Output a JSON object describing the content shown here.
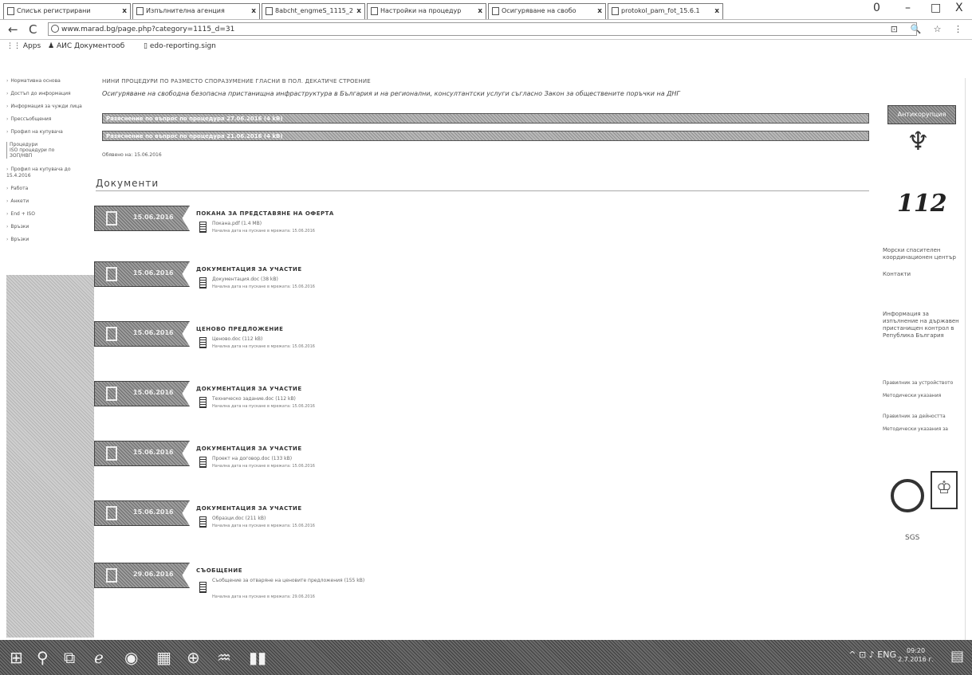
{
  "tabs": [
    {
      "label": "Списък регистрирани",
      "icon": "user-icon"
    },
    {
      "label": "Изпълнителна агенция",
      "icon": "agency-icon"
    },
    {
      "label": "8abcht_engmeS_1115_2",
      "icon": "page-icon"
    },
    {
      "label": "Настройки на процедур",
      "icon": "page-icon"
    },
    {
      "label": "Осигуряване на свобо",
      "icon": "page-icon"
    },
    {
      "label": "protokol_pam_fot_15.6.1",
      "icon": "page-icon"
    }
  ],
  "window_controls": {
    "profile": "0",
    "minimize": "–",
    "maximize": "□",
    "close": "X"
  },
  "address": {
    "url": "www.marad.bg/page.php?category=1115_d=31",
    "back": "←",
    "reload": "C",
    "icons": "⊡ 🔍 ☆ ⋮"
  },
  "bookmarks": [
    {
      "label": "Apps",
      "icon": "apps-icon"
    },
    {
      "label": "AИС Документооб",
      "icon": "user-icon"
    },
    {
      "label": "edo-reporting.sign",
      "icon": "page-icon"
    }
  ],
  "sidebar": {
    "items": [
      "Нормативна основа",
      "Достъп до информация",
      "Информация за чужди лица",
      "Прессъобщения",
      "Профил на купувача",
      "Профил на купувача до 15.4.2016",
      "Работа",
      "Анкети",
      "Еnd + ISO",
      "Връзки",
      "Връзки"
    ],
    "sub": [
      "Процедури",
      "ISO процедури по",
      "ЗОП/НВП"
    ]
  },
  "main": {
    "crumb": "НИНИ ПРОЦЕДУРИ ПО РАЗМЕСТО СПОРАЗУМЕНИЕ ГЛАСНИ В ПОЛ. ДЕКАТИЧЕ СТРОЕНИЕ",
    "announcement": "Осигуряване на свободна безопасна пристанищна инфраструктура в България и на регионални, консултантски услуги съгласно Закон за обществените поръчки на ДНГ",
    "bars": [
      "Разяснение по въпрос по процедура 27.06.2016 (4 kB)",
      "Разяснение по въпрос по процедура 21.06.2016 (4 kB)"
    ],
    "published": "Обявено на: 15.06.2016",
    "docs_title": "Документи",
    "documents": [
      {
        "date": "15.06.2016",
        "type": "ПОКАНА ЗА ПРЕДСТАВЯНЕ НА ОФЕРТА",
        "file": "Покана.pdf (1.4 MB)",
        "meta": "Начална дата на пускане в мрежата: 15.06.2016"
      },
      {
        "date": "15.06.2016",
        "type": "ДОКУМЕНТАЦИЯ ЗА УЧАСТИЕ",
        "file": "Документация.doc (38 kB)",
        "meta": "Начална дата на пускане в мрежата: 15.06.2016"
      },
      {
        "date": "15.06.2016",
        "type": "ЦЕНОВО ПРЕДЛОЖЕНИЕ",
        "file": "Ценово.doc (112 kB)",
        "meta": "Начална дата на пускане в мрежата: 15.06.2016"
      },
      {
        "date": "15.06.2016",
        "type": "ДОКУМЕНТАЦИЯ ЗА УЧАСТИЕ",
        "file": "Техническо задание.doc (112 kB)",
        "meta": "Начална дата на пускане в мрежата: 15.06.2016"
      },
      {
        "date": "15.06.2016",
        "type": "ДОКУМЕНТАЦИЯ ЗА УЧАСТИЕ",
        "file": "Проект на договор.doc (133 kB)",
        "meta": "Начална дата на пускане в мрежата: 15.06.2016"
      },
      {
        "date": "15.06.2016",
        "type": "ДОКУМЕНТАЦИЯ ЗА УЧАСТИЕ",
        "file": "Образци.doc (211 kB)",
        "meta": "Начална дата на пускане в мрежата: 15.06.2016"
      },
      {
        "date": "29.06.2016",
        "type": "СЪОБЩЕНИЕ",
        "file": "Съобщение за отваряне на ценовите предложения (155 kB)",
        "meta": "Начална дата на пускане в мрежата: 29.06.2016"
      }
    ]
  },
  "right": {
    "button": "Антикорупция",
    "text1": "Морски спасителен координационен център",
    "text2": "Контакти",
    "text3": "Информация за изпълнение на държавен пристанищен контрол в Република България",
    "links": [
      "Правилник за устройството",
      "Методически указания",
      "Правилник за дейността",
      "Методически указания за"
    ],
    "seal_caption": "SGS"
  },
  "taskbar": {
    "icons": [
      "windows-icon",
      "search-icon",
      "task-view-icon",
      "edge-icon",
      "chrome-icon",
      "store-icon",
      "globe-icon",
      "app-icon",
      "explorer-icon"
    ],
    "tray": "^ ⊡ ♪ ENG",
    "time": "09:20",
    "date": "2.7.2016 г."
  }
}
